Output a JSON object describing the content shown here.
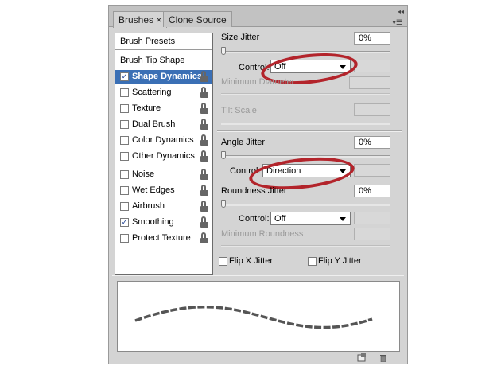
{
  "tabs": {
    "brushes": "Brushes ×",
    "clone_source": "Clone Source"
  },
  "left": {
    "presets": "Brush Presets",
    "tip_shape": "Brush Tip Shape",
    "items": [
      {
        "label": "Shape Dynamics",
        "checked": true,
        "selected": true,
        "lock": true
      },
      {
        "label": "Scattering",
        "checked": false,
        "selected": false,
        "lock": true
      },
      {
        "label": "Texture",
        "checked": false,
        "selected": false,
        "lock": true
      },
      {
        "label": "Dual Brush",
        "checked": false,
        "selected": false,
        "lock": true
      },
      {
        "label": "Color Dynamics",
        "checked": false,
        "selected": false,
        "lock": true
      },
      {
        "label": "Other Dynamics",
        "checked": false,
        "selected": false,
        "lock": true
      },
      {
        "label": "Noise",
        "checked": false,
        "selected": false,
        "lock": true
      },
      {
        "label": "Wet Edges",
        "checked": false,
        "selected": false,
        "lock": true
      },
      {
        "label": "Airbrush",
        "checked": false,
        "selected": false,
        "lock": true
      },
      {
        "label": "Smoothing",
        "checked": true,
        "selected": false,
        "lock": true
      },
      {
        "label": "Protect Texture",
        "checked": false,
        "selected": false,
        "lock": true
      }
    ]
  },
  "right": {
    "size_jitter_label": "Size Jitter",
    "size_jitter_value": "0%",
    "control1_label": "Control:",
    "control1_value": "Off",
    "min_diameter_label": "Minimum Diameter",
    "tilt_scale_label": "Tilt Scale",
    "angle_jitter_label": "Angle Jitter",
    "angle_jitter_value": "0%",
    "control2_label": "Control:",
    "control2_value": "Direction",
    "roundness_jitter_label": "Roundness Jitter",
    "roundness_jitter_value": "0%",
    "control3_label": "Control:",
    "control3_value": "Off",
    "min_roundness_label": "Minimum Roundness",
    "flip_x_label": "Flip X Jitter",
    "flip_y_label": "Flip Y Jitter"
  },
  "colors": {
    "selection": "#3a6fb5",
    "annotation": "#b3242b",
    "panel": "#d4d4d4"
  },
  "icons": [
    "collapse-icon",
    "panel-menu-icon",
    "lock-icon",
    "new-brush-icon",
    "trash-icon"
  ]
}
